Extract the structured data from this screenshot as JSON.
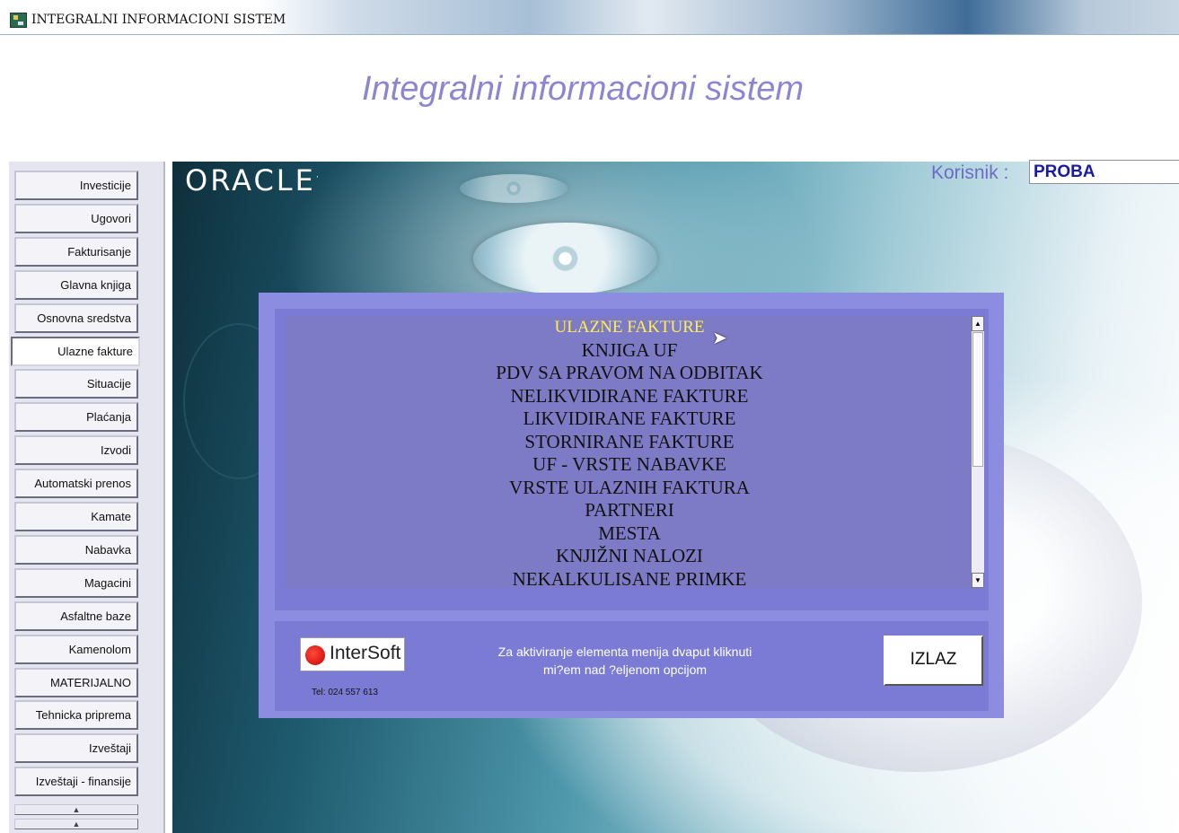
{
  "window": {
    "title": "INTEGRALNI INFORMACIONI SISTEM",
    "icon": "app-icon"
  },
  "heading": "Integralni informacioni sistem",
  "brand": {
    "oracle": "ORACLE",
    "oracle_mark": "·"
  },
  "user": {
    "label": "Korisnik :",
    "value": "PROBA"
  },
  "menu": {
    "items": [
      {
        "label": "Investicije"
      },
      {
        "label": "Ugovori"
      },
      {
        "label": "Fakturisanje"
      },
      {
        "label": "Glavna knjiga"
      },
      {
        "label": "Osnovna sredstva"
      },
      {
        "label": "Ulazne fakture",
        "active": true
      },
      {
        "label": "Situacije"
      },
      {
        "label": "Plaćanja"
      },
      {
        "label": "Izvodi"
      },
      {
        "label": "Automatski prenos"
      },
      {
        "label": "Kamate"
      },
      {
        "label": "Nabavka"
      },
      {
        "label": "Magacini"
      },
      {
        "label": "Asfaltne baze"
      },
      {
        "label": "Kamenolom"
      },
      {
        "label": "MATERIJALNO"
      },
      {
        "label": "Tehnicka priprema"
      },
      {
        "label": "Izveštaji"
      },
      {
        "label": "Izveštaji - finansije"
      }
    ],
    "scroll_up_glyph": "▲"
  },
  "dialog": {
    "list": [
      "ULAZNE FAKTURE",
      "KNJIGA UF",
      "PDV SA PRAVOM NA ODBITAK",
      "NELIKVIDIRANE FAKTURE",
      "LIKVIDIRANE FAKTURE",
      "STORNIRANE FAKTURE",
      "UF - VRSTE NABAVKE",
      "VRSTE ULAZNIH FAKTURA",
      "PARTNERI",
      "MESTA",
      "KNJIŽNI NALOZI",
      "NEKALKULISANE PRIMKE"
    ],
    "selected_index": 0,
    "selected_color": "#ffee55",
    "scroll_up": "▲",
    "scroll_down": "▼",
    "hint_line1": "Za aktiviranje elementa menija dvaput kliknuti",
    "hint_line2": "mi?em nad ?eljenom opcijom",
    "exit_button": "IZLAZ",
    "vendor": {
      "name": "InterSoft",
      "tel": "Tel: 024 557 613"
    }
  },
  "colors": {
    "dialog_bg": "#8c8ce0",
    "list_bg": "#7d7bc5",
    "heading": "#8c85d2",
    "user_label": "#6c6cc8",
    "user_value": "#1a1aa8"
  }
}
